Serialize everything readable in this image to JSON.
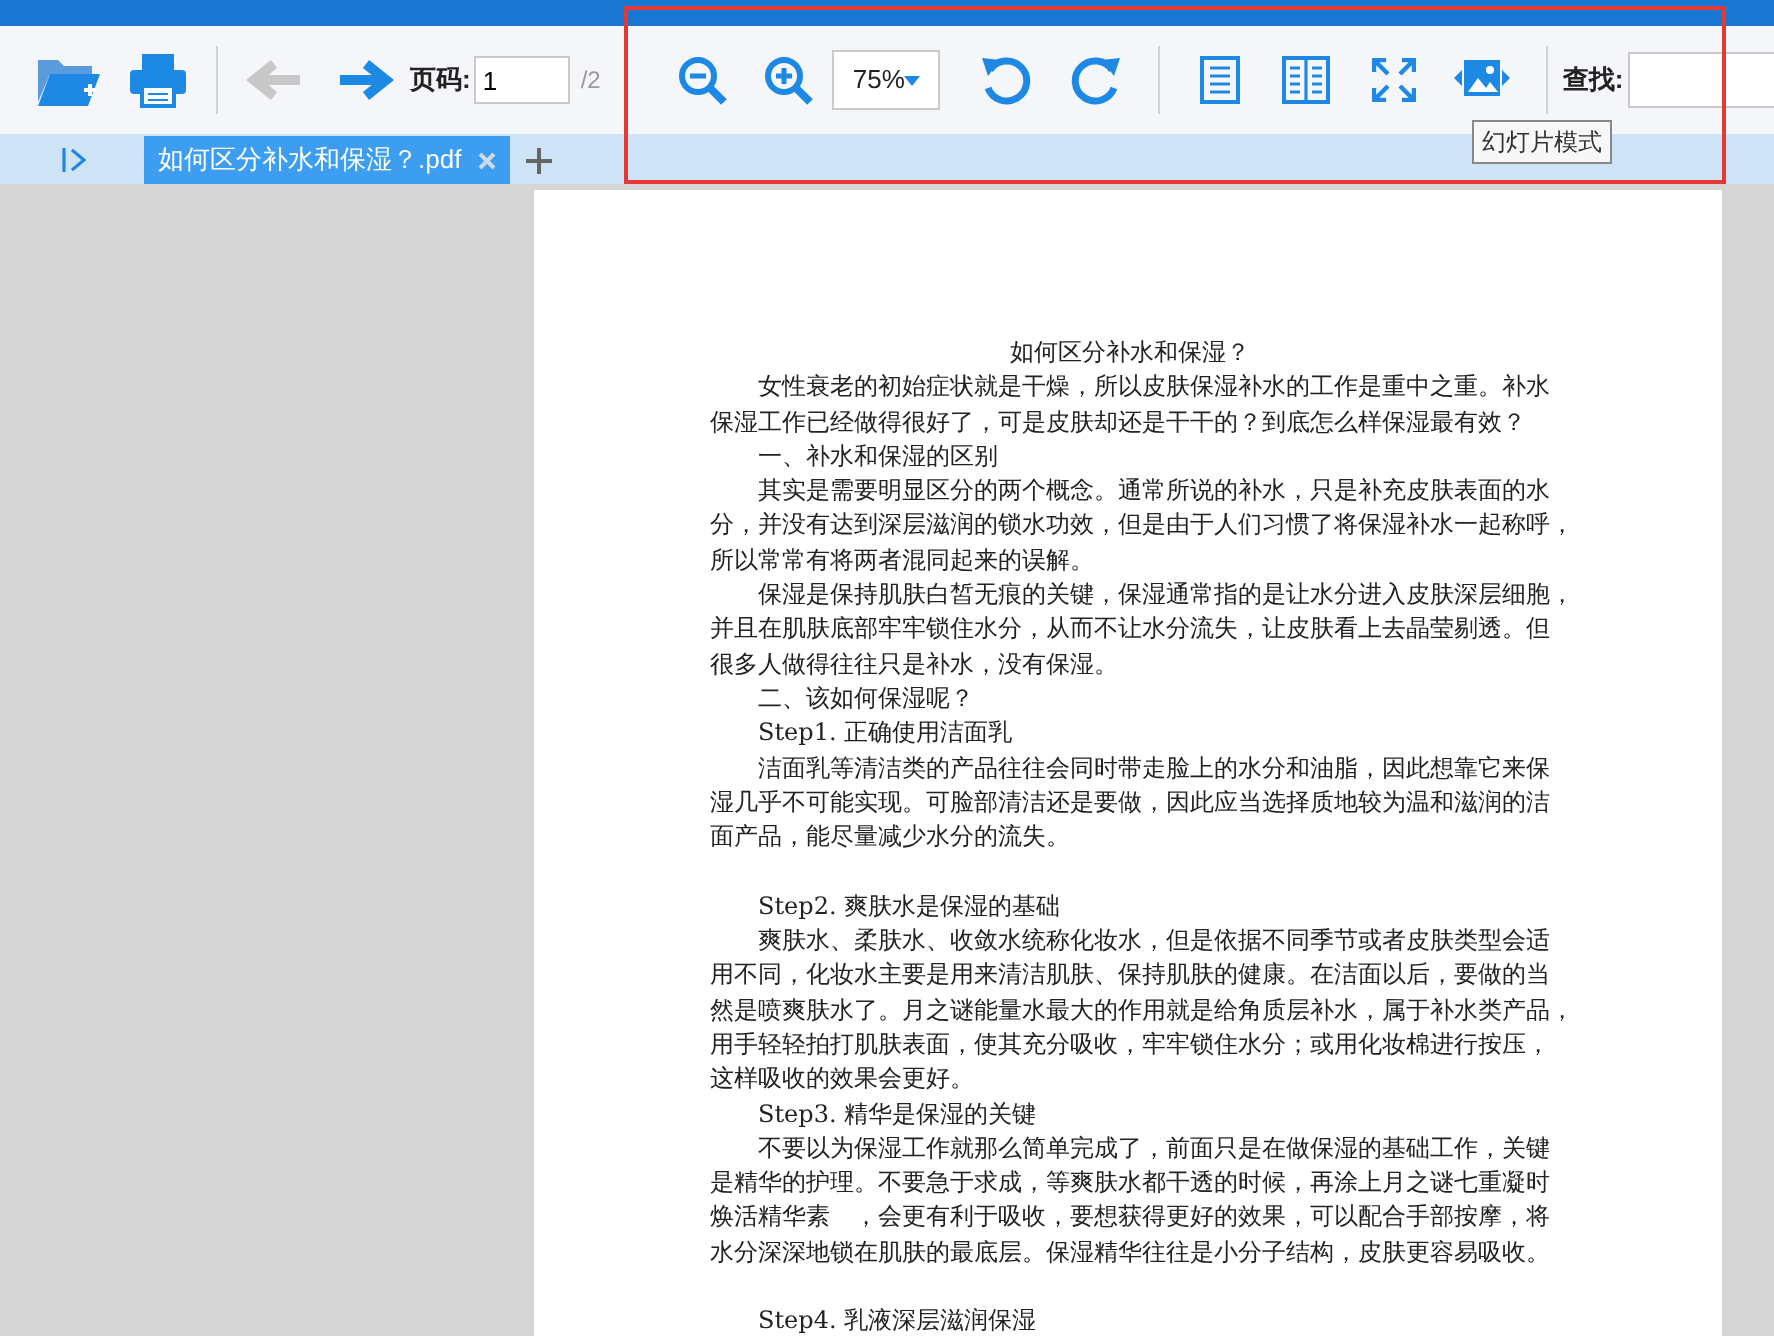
{
  "toolbar": {
    "back_disabled": true,
    "forward_disabled": false,
    "page_label": "页码:",
    "page_value": "1",
    "page_total": "/2",
    "zoom_value": "75%",
    "find_label": "查找:"
  },
  "tooltip": "幻灯片模式",
  "tabs": [
    {
      "label": "如何区分补水和保湿？.pdf",
      "selected": true
    }
  ],
  "document": {
    "title": "如何区分补水和保湿？",
    "paragraphs": [
      {
        "spaced_before": false,
        "lines": [
          "女性衰老的初始症状就是干燥，所以皮肤保湿补水的工作是重中之重。补水",
          "保湿工作已经做得很好了，可是皮肤却还是干干的？到底怎么样保湿最有效？"
        ]
      },
      {
        "spaced_before": false,
        "lines": [
          "一、补水和保湿的区别"
        ]
      },
      {
        "spaced_before": false,
        "lines": [
          "其实是需要明显区分的两个概念。通常所说的补水，只是补充皮肤表面的水",
          "分，并没有达到深层滋润的锁水功效，但是由于人们习惯了将保湿补水一起称呼，",
          "所以常常有将两者混同起来的误解。"
        ]
      },
      {
        "spaced_before": false,
        "lines": [
          "保湿是保持肌肤白皙无痕的关键，保湿通常指的是让水分进入皮肤深层细胞，",
          "并且在肌肤底部牢牢锁住水分，从而不让水分流失，让皮肤看上去晶莹剔透。但",
          "很多人做得往往只是补水，没有保湿。"
        ]
      },
      {
        "spaced_before": false,
        "lines": [
          "二、该如何保湿呢？"
        ]
      },
      {
        "spaced_before": false,
        "lines": [
          "Step1. 正确使用洁面乳"
        ]
      },
      {
        "spaced_before": false,
        "lines": [
          "洁面乳等清洁类的产品往往会同时带走脸上的水分和油脂，因此想靠它来保",
          "湿几乎不可能实现。可脸部清洁还是要做，因此应当选择质地较为温和滋润的洁",
          "面产品，能尽量减少水分的流失。"
        ]
      },
      {
        "spaced_before": true,
        "lines": [
          "Step2. 爽肤水是保湿的基础"
        ]
      },
      {
        "spaced_before": false,
        "lines": [
          "爽肤水、柔肤水、收敛水统称化妆水，但是依据不同季节或者皮肤类型会适",
          "用不同，化妆水主要是用来清洁肌肤、保持肌肤的健康。在洁面以后，要做的当",
          "然是喷爽肤水了。月之谜能量水最大的作用就是给角质层补水，属于补水类产品，",
          "用手轻轻拍打肌肤表面，使其充分吸收，牢牢锁住水分；或用化妆棉进行按压，",
          "这样吸收的效果会更好。"
        ]
      },
      {
        "spaced_before": false,
        "lines": [
          "Step3. 精华是保湿的关键"
        ]
      },
      {
        "spaced_before": false,
        "lines": [
          "不要以为保湿工作就那么简单完成了，前面只是在做保湿的基础工作，关键",
          "是精华的护理。不要急于求成，等爽肤水都干透的时候，再涂上月之谜七重凝时",
          "焕活精华素　，会更有利于吸收，要想获得更好的效果，可以配合手部按摩，将",
          "水分深深地锁在肌肤的最底层。保湿精华往往是小分子结构，皮肤更容易吸收。"
        ]
      },
      {
        "spaced_before": true,
        "lines": [
          "Step4. 乳液深层滋润保湿"
        ]
      }
    ]
  }
}
